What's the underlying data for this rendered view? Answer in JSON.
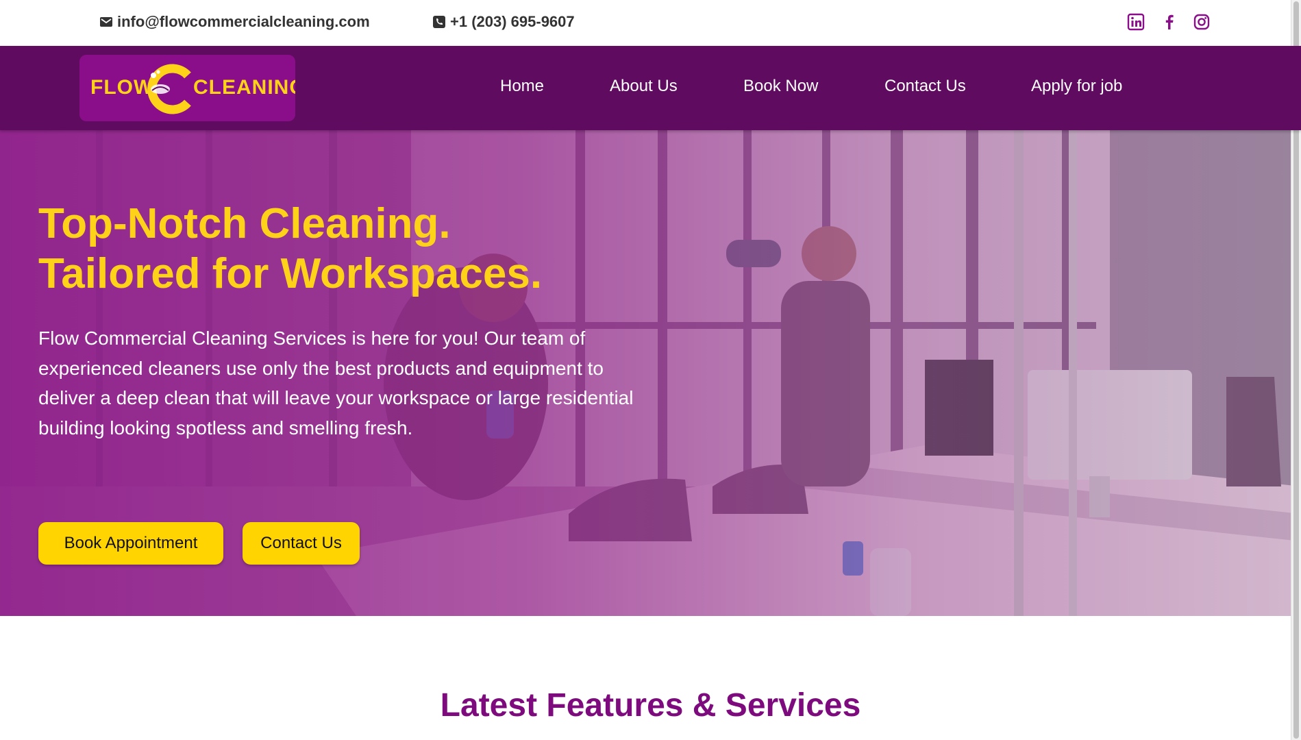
{
  "topbar": {
    "email": "info@flowcommercialcleaning.com",
    "phone": "+1 (203) 695-9607",
    "socials": [
      {
        "name": "linkedin-icon"
      },
      {
        "name": "facebook-icon"
      },
      {
        "name": "instagram-icon"
      }
    ]
  },
  "brand": {
    "logo_left": "FLOW",
    "logo_right": "CLEANING",
    "colors": {
      "primary": "#5f0b5f",
      "accent": "#ffd21a",
      "logo_bg": "#8a0d8a",
      "heading": "#7d0b7d"
    }
  },
  "nav": {
    "items": [
      {
        "label": "Home"
      },
      {
        "label": "About Us"
      },
      {
        "label": "Book Now"
      },
      {
        "label": "Contact Us"
      },
      {
        "label": "Apply for job"
      }
    ]
  },
  "hero": {
    "title_line1": "Top-Notch Cleaning.",
    "title_line2": "Tailored for Workspaces.",
    "description": "Flow Commercial Cleaning Services is here for you! Our team of experienced cleaners use only the best products and equipment to deliver a deep clean that will leave your workspace or large residential building looking spotless and smelling fresh.",
    "primary_button": "Book Appointment",
    "secondary_button": "Contact Us"
  },
  "features": {
    "title": "Latest Features & Services"
  }
}
